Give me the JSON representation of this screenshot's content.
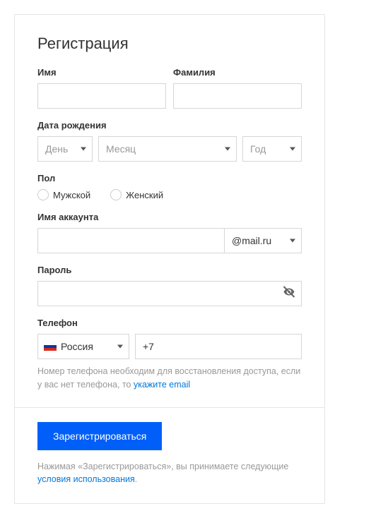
{
  "title": "Регистрация",
  "name": {
    "first_label": "Имя",
    "last_label": "Фамилия"
  },
  "dob": {
    "label": "Дата рождения",
    "day_placeholder": "День",
    "month_placeholder": "Месяц",
    "year_placeholder": "Год"
  },
  "gender": {
    "label": "Пол",
    "male": "Мужской",
    "female": "Женский"
  },
  "account": {
    "label": "Имя аккаунта",
    "domain": "@mail.ru"
  },
  "password": {
    "label": "Пароль"
  },
  "phone": {
    "label": "Телефон",
    "country": "Россия",
    "prefix": "+7",
    "hint_pre": "Номер телефона необходим для восстановления доступа, если у вас нет телефона, то ",
    "hint_link": "укажите email"
  },
  "submit": "Зарегистрироваться",
  "terms": {
    "pre": "Нажимая «Зарегистрироваться», вы принимаете следующие ",
    "link": "условия использования",
    "post": "."
  }
}
